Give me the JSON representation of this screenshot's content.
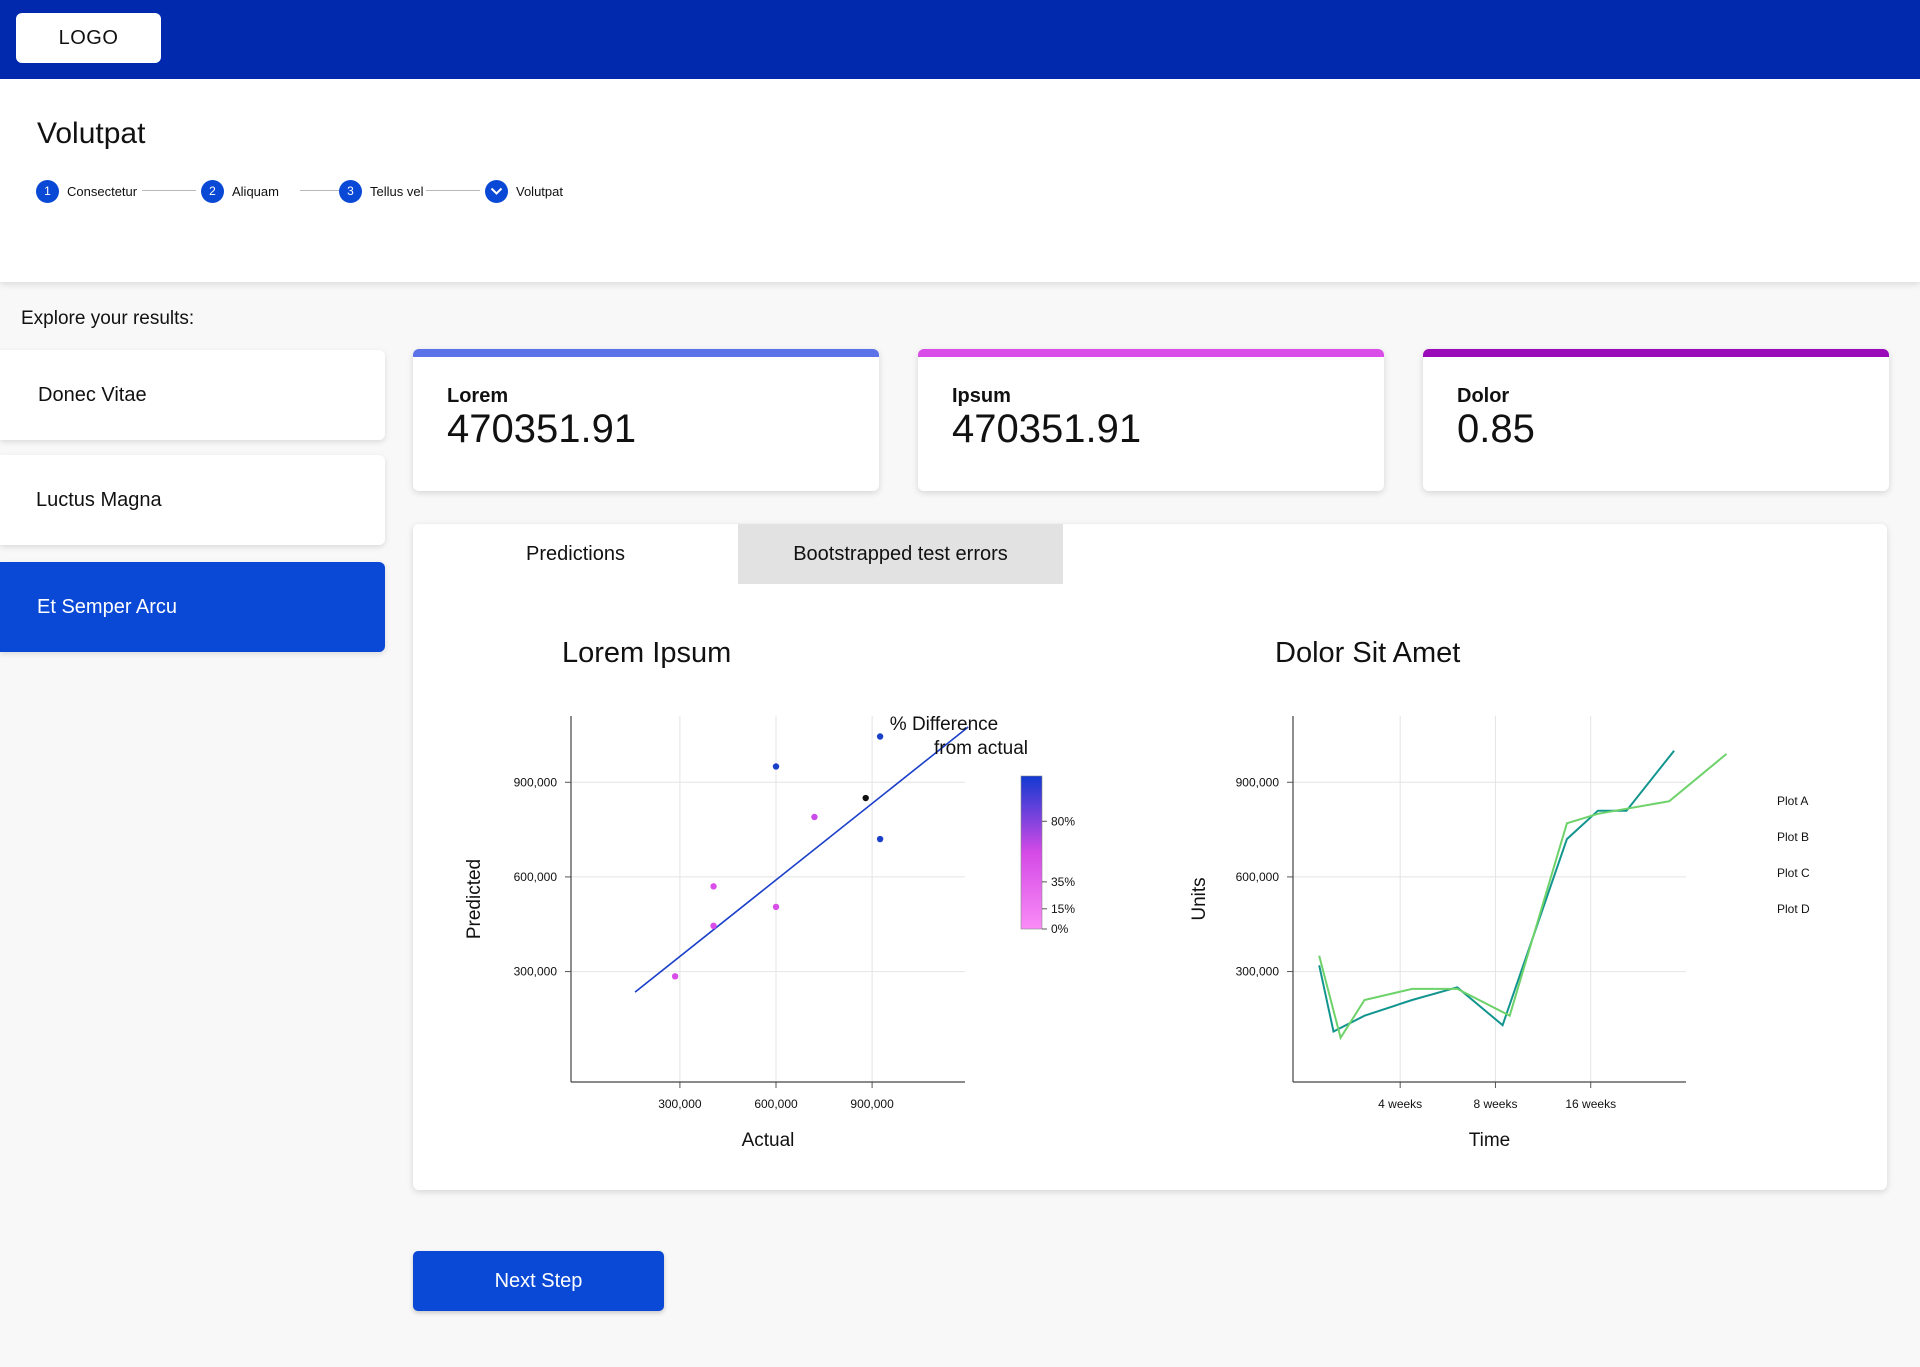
{
  "header": {
    "logo_label": "LOGO"
  },
  "page": {
    "title": "Volutpat"
  },
  "stepper": {
    "steps": [
      {
        "number": "1",
        "label": "Consectetur"
      },
      {
        "number": "2",
        "label": "Aliquam"
      },
      {
        "number": "3",
        "label": "Tellus vel"
      },
      {
        "number": "",
        "label": "Volutpat"
      }
    ]
  },
  "sidebar": {
    "heading": "Explore your results:",
    "items": [
      {
        "label": "Donec Vitae"
      },
      {
        "label": "Luctus Magna"
      },
      {
        "label": "Et Semper Arcu"
      }
    ]
  },
  "metrics": [
    {
      "label": "Lorem",
      "value": "470351.91",
      "color": "#5c72e8"
    },
    {
      "label": "Ipsum",
      "value": "470351.91",
      "color": "#d94de8"
    },
    {
      "label": "Dolor",
      "value": "0.85",
      "color": "#9b0ab8"
    }
  ],
  "tabs": [
    {
      "label": "Predictions"
    },
    {
      "label": "Bootstrapped test errors"
    }
  ],
  "footer": {
    "next_label": "Next Step"
  },
  "chart_data": [
    {
      "type": "scatter",
      "title": "Lorem Ipsum",
      "xlabel": "Actual",
      "ylabel": "Predicted",
      "xticks": [
        "300,000",
        "600,000",
        "900,000"
      ],
      "xtick_values": [
        300000,
        600000,
        900000
      ],
      "yticks": [
        "300,000",
        "600,000",
        "900,000"
      ],
      "ytick_values": [
        300000,
        600000,
        900000
      ],
      "xlim": [
        -40000,
        1190000
      ],
      "ylim": [
        -50000,
        1110000
      ],
      "grid": true,
      "points": [
        {
          "x": 600000,
          "y": 950000,
          "color": "#1a3fc9"
        },
        {
          "x": 925000,
          "y": 1045000,
          "color": "#1a3fc9"
        },
        {
          "x": 925000,
          "y": 720000,
          "color": "#1a3fc9"
        },
        {
          "x": 880000,
          "y": 850000,
          "color": "#111111"
        },
        {
          "x": 720000,
          "y": 790000,
          "color": "#c94de8"
        },
        {
          "x": 600000,
          "y": 505000,
          "color": "#d94de8"
        },
        {
          "x": 405000,
          "y": 570000,
          "color": "#d94de8"
        },
        {
          "x": 405000,
          "y": 445000,
          "color": "#d94de8"
        },
        {
          "x": 285000,
          "y": 285000,
          "color": "#d94de8"
        }
      ],
      "fit_line": {
        "x": [
          160000,
          1200000
        ],
        "y": [
          235000,
          1075000
        ],
        "color": "#1a3fc9"
      },
      "colorbar": {
        "title": [
          "% Difference",
          "from actual"
        ],
        "ticks": [
          "80%",
          "35%",
          "15%",
          "0%"
        ],
        "tick_values": [
          80,
          35,
          15,
          0
        ],
        "colors": [
          "#1239d1",
          "#d44ae6",
          "#f98cf7"
        ]
      }
    },
    {
      "type": "line",
      "title": "Dolor Sit Amet",
      "xlabel": "Time",
      "ylabel": "Units",
      "xticks": [
        "4 weeks",
        "8 weeks",
        "16 weeks"
      ],
      "xtick_values": [
        4,
        8,
        12
      ],
      "yticks": [
        "300,000",
        "600,000",
        "900,000"
      ],
      "ytick_values": [
        300000,
        600000,
        900000
      ],
      "xlim": [
        -0.5,
        16
      ],
      "ylim": [
        -50000,
        1110000
      ],
      "grid": true,
      "legend": [
        "Plot A",
        "Plot B",
        "Plot C",
        "Plot D"
      ],
      "legend_position": "right",
      "series": [
        {
          "color": "#13958f",
          "x": [
            0.6,
            1.2,
            2.5,
            4.5,
            6.4,
            8.3,
            11,
            12.3,
            13.5,
            15.5
          ],
          "y": [
            320000,
            110000,
            160000,
            210000,
            250000,
            130000,
            720000,
            810000,
            810000,
            1000000
          ]
        },
        {
          "color": "#6ed26a",
          "x": [
            0.6,
            1.5,
            2.5,
            4.5,
            6.4,
            8.6,
            11,
            12.3,
            15.3,
            17.7
          ],
          "y": [
            350000,
            90000,
            210000,
            245000,
            245000,
            160000,
            770000,
            800000,
            840000,
            990000
          ]
        }
      ]
    }
  ]
}
